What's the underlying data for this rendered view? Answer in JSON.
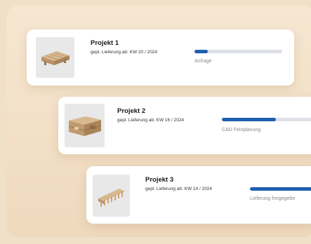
{
  "projects": [
    {
      "title": "Projekt 1",
      "delivery": "gepl. Lieferung ab: KW 20 / 2024",
      "status": "Anfrage",
      "progress": 0.15,
      "image_icon": "furniture-bench-icon"
    },
    {
      "title": "Projekt 2",
      "delivery": "gepl. Lieferung ab: KW 16 / 2024",
      "status": "CAD Feinplanung",
      "progress": 0.55,
      "image_icon": "furniture-cabinet-icon"
    },
    {
      "title": "Projekt 3",
      "delivery": "gepl. Lieferung ab: KW 14 / 2024",
      "status": "Lieferung freigegebe",
      "progress": 1.0,
      "image_icon": "furniture-rack-icon"
    }
  ],
  "colors": {
    "background": "#f1e0c8",
    "card": "#ffffff",
    "progress_fill": "#1f5fae",
    "progress_track": "#dde0e6",
    "thumb_bg": "#e8e8e8",
    "wood": "#c9a57a"
  }
}
